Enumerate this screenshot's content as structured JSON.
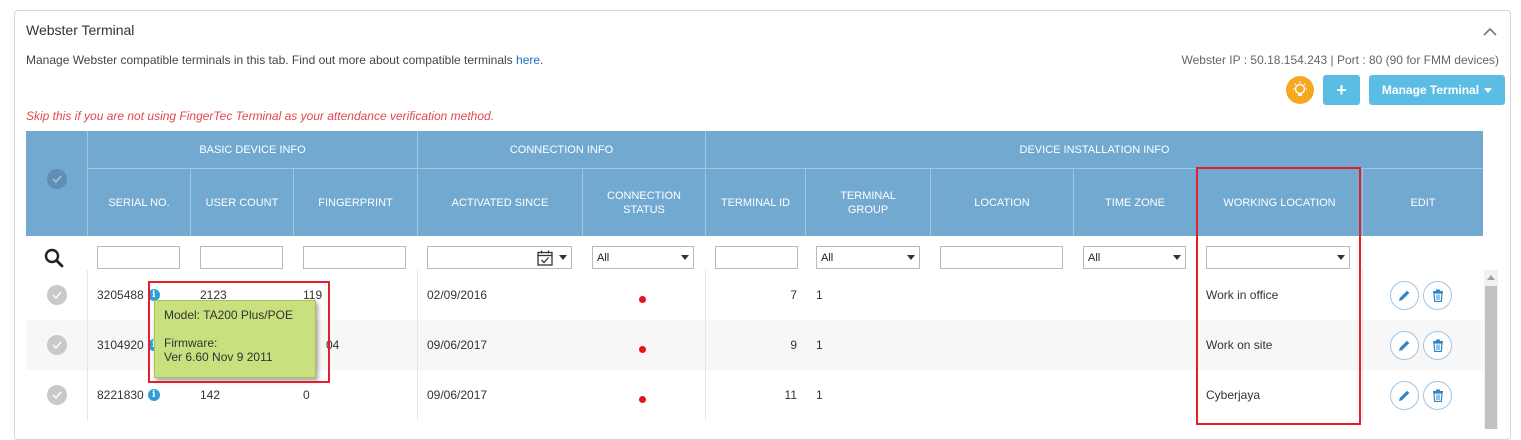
{
  "panel": {
    "title": "Webster Terminal",
    "description": "Manage Webster compatible terminals in this tab. Find out more about compatible terminals ",
    "link_text": "here",
    "description_end": ".",
    "ip_info": "Webster IP : 50.18.154.243 | Port : 80 (90 for FMM devices)",
    "warning": "Skip this if you are not using FingerTec Terminal as your attendance verification method.",
    "manage_button": "Manage Terminal",
    "add_button": "+"
  },
  "table": {
    "groups": {
      "basic": "BASIC DEVICE INFO",
      "connection": "CONNECTION INFO",
      "installation": "DEVICE INSTALLATION INFO"
    },
    "columns": {
      "serial": "SERIAL NO.",
      "user_count": "USER COUNT",
      "fingerprint": "FINGERPRINT",
      "activated": "ACTIVATED SINCE",
      "conn_status": "CONNECTION STATUS",
      "terminal_id": "TERMINAL ID",
      "terminal_group": "TERMINAL GROUP",
      "location": "LOCATION",
      "time_zone": "TIME ZONE",
      "working_location": "WORKING LOCATION",
      "edit": "EDIT"
    },
    "filters": {
      "conn_status": "All",
      "terminal_group": "All",
      "time_zone": "All",
      "working_location": ""
    },
    "rows": [
      {
        "serial": "3205488",
        "user_count": "2123",
        "fingerprint": "119",
        "activated": "02/09/2016",
        "terminal_id": "7",
        "terminal_group": "1",
        "location": "",
        "time_zone": "",
        "working_location": "Work in office"
      },
      {
        "serial": "3104920",
        "user_count": "",
        "fingerprint": "04",
        "activated": "09/06/2017",
        "terminal_id": "9",
        "terminal_group": "1",
        "location": "",
        "time_zone": "",
        "working_location": "Work on site"
      },
      {
        "serial": "8221830",
        "user_count": "142",
        "fingerprint": "0",
        "activated": "09/06/2017",
        "terminal_id": "11",
        "terminal_group": "1",
        "location": "",
        "time_zone": "",
        "working_location": "Cyberjaya"
      }
    ]
  },
  "tooltip": {
    "model": "Model: TA200 Plus/POE",
    "firmware_label": "Firmware:",
    "firmware_value": "Ver 6.60 Nov 9 2011"
  },
  "colors": {
    "header_blue": "#72a9d0",
    "button_blue": "#5bbde4",
    "bulb_orange": "#f7a823",
    "status_red": "#e2141c",
    "highlight_red": "#e2202a",
    "tooltip_green": "#c8e07e"
  }
}
